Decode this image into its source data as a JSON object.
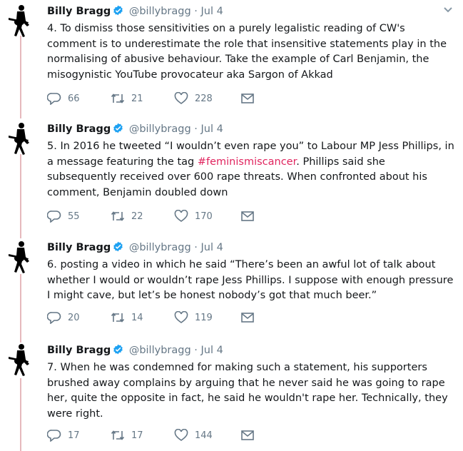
{
  "tweets": [
    {
      "name": "Billy Bragg",
      "handle": "@billybragg",
      "separator": "·",
      "date": "Jul 4",
      "text_before": "4. To dismiss those sensitivities on a purely legalistic reading of CW's comment is to underestimate the role that insensitive statements play in the normalising of abusive behaviour. Take the example of Carl Benjamin, the misogynistic YouTube provocateur aka Sargon of Akkad",
      "hashtag": "",
      "text_after": "",
      "replies": "66",
      "retweets": "21",
      "likes": "228"
    },
    {
      "name": "Billy Bragg",
      "handle": "@billybragg",
      "separator": "·",
      "date": "Jul 4",
      "text_before": "5. In 2016 he tweeted “I wouldn’t even rape you” to Labour MP Jess Phillips, in a message featuring the tag ",
      "hashtag": "#feminismiscancer",
      "text_after": ". Phillips said she subsequently received over 600 rape threats. When confronted about his comment, Benjamin doubled down",
      "replies": "55",
      "retweets": "22",
      "likes": "170"
    },
    {
      "name": "Billy Bragg",
      "handle": "@billybragg",
      "separator": "·",
      "date": "Jul 4",
      "text_before": "6. posting a video in which he said “There’s been an awful lot of talk about whether I would or wouldn’t rape Jess Phillips. I suppose with enough pressure I might cave, but let’s be honest nobody’s got that much beer.”",
      "hashtag": "",
      "text_after": "",
      "replies": "20",
      "retweets": "14",
      "likes": "119"
    },
    {
      "name": "Billy Bragg",
      "handle": "@billybragg",
      "separator": "·",
      "date": "Jul 4",
      "text_before": "7. When he was condemned for making such a statement, his supporters brushed away complains by arguing that he never said he was going to rape her, quite the opposite in fact, he said he wouldn't rape her. Technically, they were right.",
      "hashtag": "",
      "text_after": "",
      "replies": "17",
      "retweets": "17",
      "likes": "144"
    }
  ],
  "icons": {
    "avatar": "guitarist-silhouette-avatar",
    "verified": "verified-badge-icon",
    "menu": "chevron-down-icon",
    "reply": "reply-icon",
    "retweet": "retweet-icon",
    "like": "heart-icon",
    "dm": "envelope-icon"
  },
  "colors": {
    "name": "#14171a",
    "secondary": "#657786",
    "hashtag": "#e0245e",
    "verified": "#1da1f2",
    "thread_line": "#e6b9bd"
  }
}
